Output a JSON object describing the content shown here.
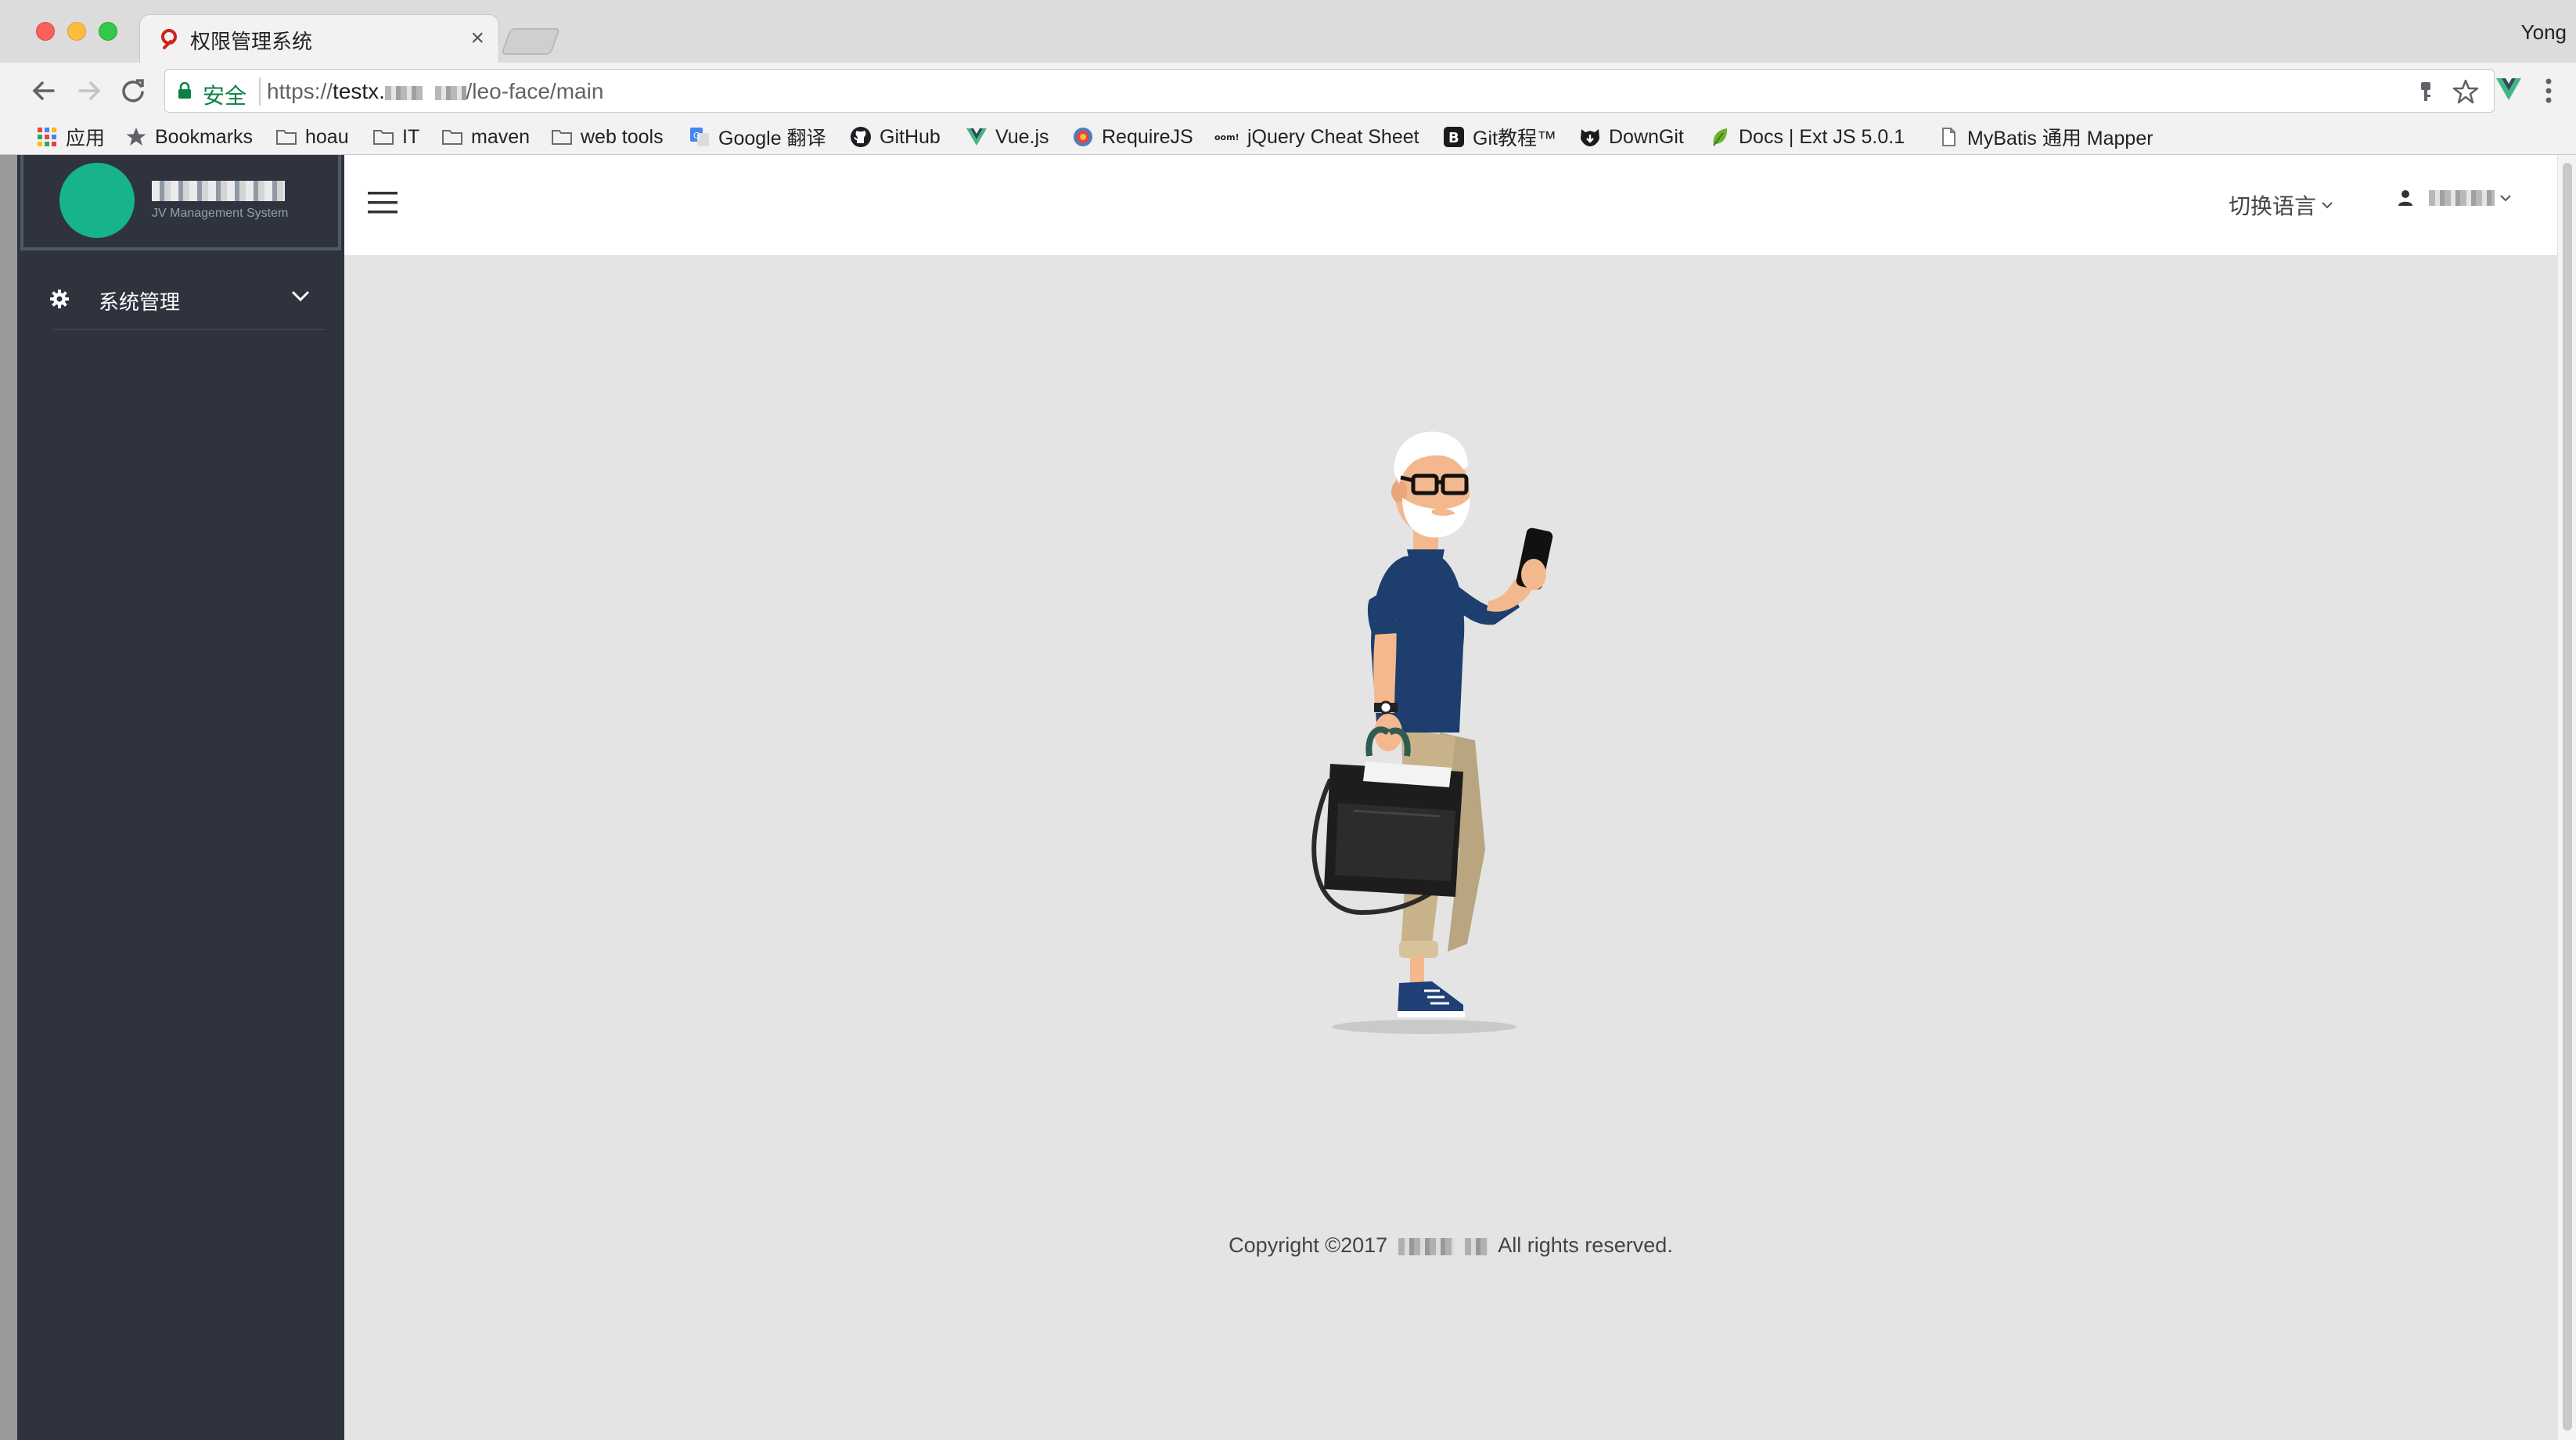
{
  "browser": {
    "tab_title": "权限管理系统",
    "tab_close": "×",
    "profile_name": "Yong",
    "secure_label": "安全",
    "url_prefix": "https://",
    "url_host_start": "testx.",
    "url_path": "/leo-face/main"
  },
  "bookmarks": [
    {
      "label": "应用",
      "icon": "apps-grid-icon"
    },
    {
      "label": "Bookmarks",
      "icon": "star-icon"
    },
    {
      "label": "hoau",
      "icon": "folder-icon"
    },
    {
      "label": "IT",
      "icon": "folder-icon"
    },
    {
      "label": "maven",
      "icon": "folder-icon"
    },
    {
      "label": "web tools",
      "icon": "folder-icon"
    },
    {
      "label": "Google 翻译",
      "icon": "google-translate-icon"
    },
    {
      "label": "GitHub",
      "icon": "github-icon"
    },
    {
      "label": "Vue.js",
      "icon": "vue-icon"
    },
    {
      "label": "RequireJS",
      "icon": "requirejs-icon"
    },
    {
      "label": "jQuery Cheat Sheet",
      "icon": "jquery-icon"
    },
    {
      "label": "Git教程™",
      "icon": "bootstrap-b-icon"
    },
    {
      "label": "DownGit",
      "icon": "downgit-icon"
    },
    {
      "label": "Docs | Ext JS 5.0.1",
      "icon": "leaf-icon"
    },
    {
      "label": "MyBatis 通用 Mapper",
      "icon": "page-icon"
    }
  ],
  "sidebar": {
    "logo_subtitle": "JV Management System",
    "menu": [
      {
        "label": "系统管理",
        "icon": "gear-icon",
        "expanded": false
      }
    ]
  },
  "header": {
    "language_switch": "切换语言"
  },
  "footer": {
    "copyright_prefix": "Copyright ©2017",
    "copyright_suffix": "All rights reserved."
  },
  "colors": {
    "sidebar_bg": "#2f333e",
    "logo_circle": "#17b38a",
    "content_bg": "#e4e4e4",
    "secure_green": "#0b8043"
  }
}
